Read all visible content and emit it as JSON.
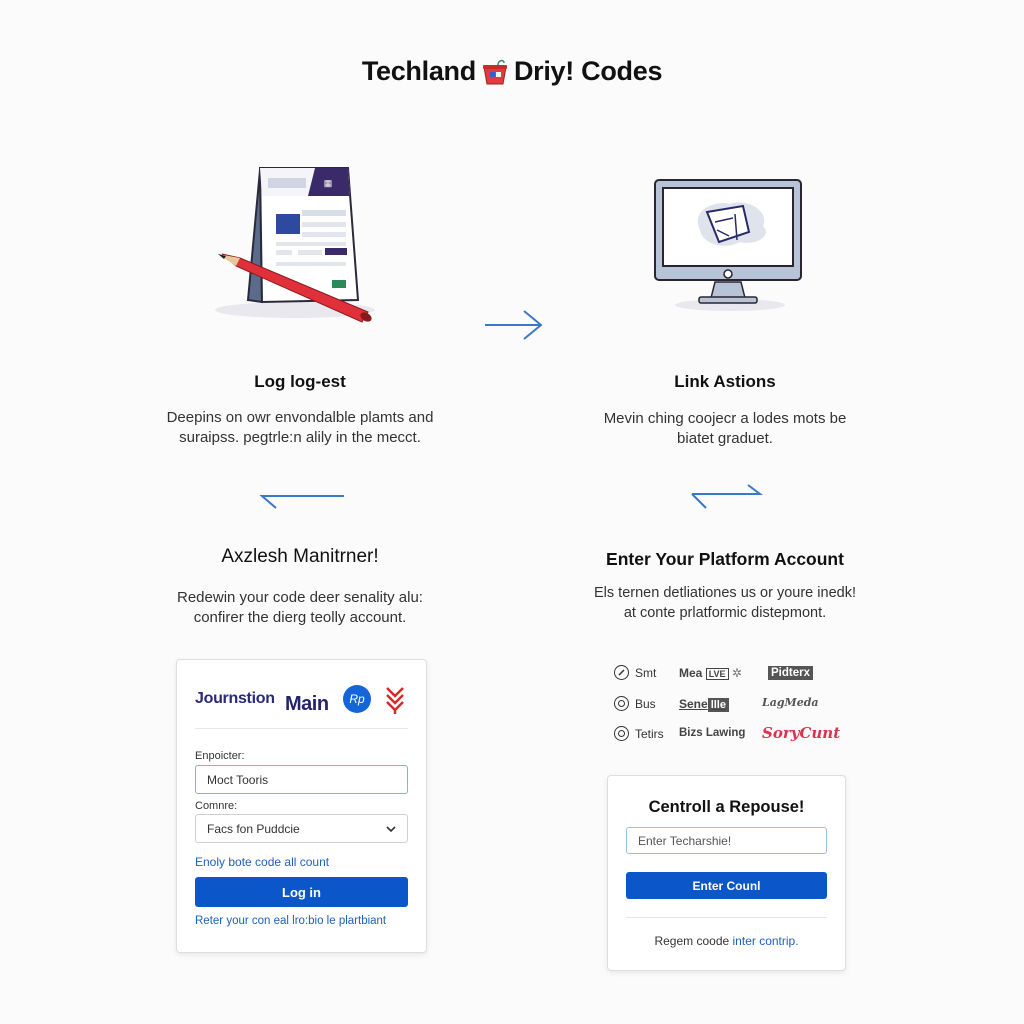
{
  "header": {
    "title_left": "Techland",
    "title_right": "Driy! Codes",
    "title_icon": "bucket-icon"
  },
  "steps": [
    {
      "title": "Log log-est",
      "description_line1": "Deepins on owr envondalble plamts and",
      "description_line2": "suraipss. pegtrle:n alily in the mecct.",
      "illustration": "document-with-pencil-icon"
    },
    {
      "title": "Link Astions",
      "description_line1": "Mevin ching coojecr a lodes mots be",
      "description_line2": "biatet graduet.",
      "illustration": "monitor-icon"
    },
    {
      "title": "Axzlesh Manitrner!",
      "description_line1": "Redewin your code deer senality alu:",
      "description_line2": "confirer the dierg teolly account."
    },
    {
      "title": "Enter Your Platform Account",
      "description_line1": "Els ternen detliationes us or youre inedk!",
      "description_line2": "at conte prlatformic distepmont."
    }
  ],
  "arrows": {
    "top": "arrow-right-icon",
    "left": "arrow-left-icon",
    "right": "arrow-exchange-icon"
  },
  "login_card": {
    "logos": [
      "Journstion",
      "Main",
      "Rp",
      "chevron-logo"
    ],
    "field1_label": "Enpoicter:",
    "field1_value": "Moct Tooris",
    "field2_label": "Comnre:",
    "field2_value": "Facs fon Puddcie",
    "helper_link": "Enoly bote code all count",
    "login_button": "Log in",
    "footer_link": "Reter your con eal lro:bio le plartbiant"
  },
  "platforms": {
    "options": [
      {
        "label": "Smt",
        "icon": "check-circle-icon",
        "brand_a": "Mea",
        "brand_a_box": "LVE",
        "brand_b": "Pidterx"
      },
      {
        "label": "Bus",
        "icon": "radio-icon",
        "brand_a": "Sene",
        "brand_a_box": "llle",
        "brand_b": "LagMeda"
      },
      {
        "label": "Tetirs",
        "icon": "radio-icon",
        "brand_a": "Bizs Lawing",
        "brand_a_box": "",
        "brand_b": "SoryCunt"
      }
    ]
  },
  "redeem_card": {
    "title": "Centroll a Repouse!",
    "input_placeholder": "Enter Techarshie!",
    "button_label": "Enter Counl",
    "footer_text": "Regem coode",
    "footer_link": "inter contrip."
  },
  "colors": {
    "accent": "#0b57c9",
    "link": "#1f5fbf",
    "arrow": "#3a78c9",
    "brand_red": "#d8344d",
    "navy": "#25236b"
  }
}
